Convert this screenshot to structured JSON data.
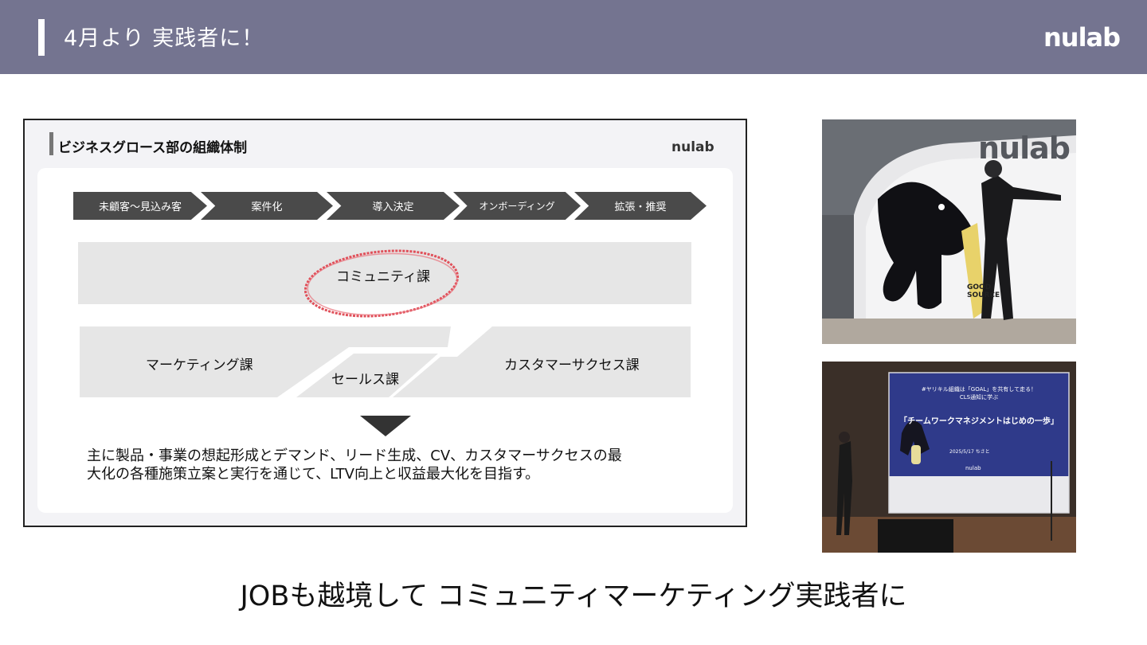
{
  "header": {
    "title": "4月より 実践者に！",
    "logo_text": "nulab"
  },
  "slide": {
    "title": "ビジネスグロース部の組織体制",
    "logo_text": "nulab",
    "steps": [
      "未顧客〜見込み客",
      "案件化",
      "導入決定",
      "オンボーディング",
      "拡張・推奨"
    ],
    "community_label": "コミュニティ課",
    "marketing_label": "マーケティング課",
    "sales_label": "セールス課",
    "cs_label": "カスタマーサクセス課",
    "summary_line1": "主に製品・事業の想起形成とデマンド、リード生成、CV、カスタマーサクセスの最",
    "summary_line2": "大化の各種施策立案と実行を通じて、LTV向上と収益最大化を目指す。"
  },
  "photo1": {
    "sign_text": "nulab",
    "bottle_text": "GOOD SOURCE"
  },
  "photo2": {
    "screen_line1": "#ヤリキル組織は「GOAL」を共有して走る！",
    "screen_line2": "CLS通知に学ぶ",
    "screen_title": "「チームワークマネジメントはじめの一歩」",
    "screen_date": "2025/5/17 ちさと",
    "screen_logo": "nulab"
  },
  "caption": "JOBも越境して コミュニティマーケティング実践者に",
  "colors": {
    "header_bg": "#747490",
    "step_bg": "#4a4a4a",
    "band_bg": "#e6e6e6",
    "circle_red": "#e0505a"
  }
}
